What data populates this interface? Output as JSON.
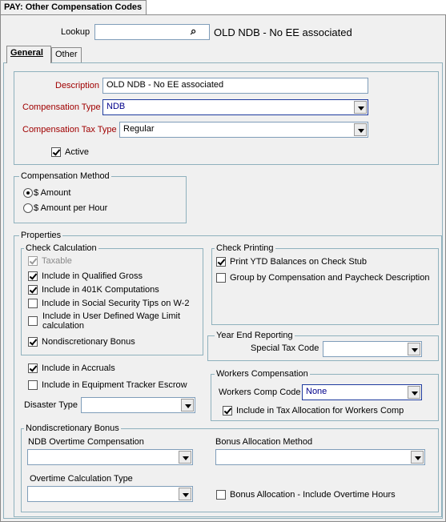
{
  "window": {
    "title": "PAY: Other Compensation Codes"
  },
  "lookup": {
    "label": "Lookup",
    "value": "",
    "display": "OLD NDB - No EE associated"
  },
  "tabs": [
    {
      "label": "General"
    },
    {
      "label": "Other"
    }
  ],
  "general": {
    "description": {
      "label": "Description",
      "value": "OLD NDB - No EE associated"
    },
    "comp_type": {
      "label": "Compensation Type",
      "value": "NDB"
    },
    "comp_tax_type": {
      "label": "Compensation Tax Type",
      "value": "Regular"
    },
    "active": {
      "label": "Active",
      "checked": true
    }
  },
  "comp_method": {
    "legend": "Compensation Method",
    "options": [
      {
        "label": "$ Amount",
        "selected": true
      },
      {
        "label": "$ Amount per Hour",
        "selected": false
      }
    ]
  },
  "properties": {
    "legend": "Properties",
    "check_calc": {
      "legend": "Check Calculation",
      "items": [
        {
          "label": "Taxable",
          "checked": true,
          "disabled": true
        },
        {
          "label": "Include in Qualified Gross",
          "checked": true
        },
        {
          "label": "Include in 401K Computations",
          "checked": true
        },
        {
          "label": "Include in Social Security Tips on W-2",
          "checked": false
        },
        {
          "label": "Include in User Defined Wage Limit",
          "label2": "calculation",
          "checked": false
        },
        {
          "label": "Nondiscretionary Bonus",
          "checked": true
        }
      ]
    },
    "accruals": {
      "label": "Include in Accruals",
      "checked": true
    },
    "escrow": {
      "label": "Include in Equipment Tracker Escrow",
      "checked": false
    },
    "disaster": {
      "label": "Disaster Type",
      "value": ""
    },
    "check_printing": {
      "legend": "Check Printing",
      "items": [
        {
          "label": "Print YTD Balances on Check Stub",
          "checked": true
        },
        {
          "label": "Group by Compensation and Paycheck Description",
          "checked": false
        }
      ]
    },
    "year_end": {
      "legend": "Year End Reporting",
      "label": "Special Tax Code",
      "value": ""
    },
    "workers_comp": {
      "legend": "Workers Compensation",
      "label": "Workers Comp Code",
      "value": "None",
      "tax_alloc": {
        "label": "Include in Tax Allocation for Workers Comp",
        "checked": true
      }
    },
    "nd_bonus": {
      "legend": "Nondiscretionary Bonus",
      "ot_comp": {
        "label": "NDB Overtime Compensation",
        "value": ""
      },
      "alloc_method": {
        "label": "Bonus Allocation Method",
        "value": ""
      },
      "ot_calc": {
        "label": "Overtime Calculation Type",
        "value": ""
      },
      "include_ot": {
        "label": "Bonus Allocation - Include Overtime Hours",
        "checked": false
      }
    }
  }
}
